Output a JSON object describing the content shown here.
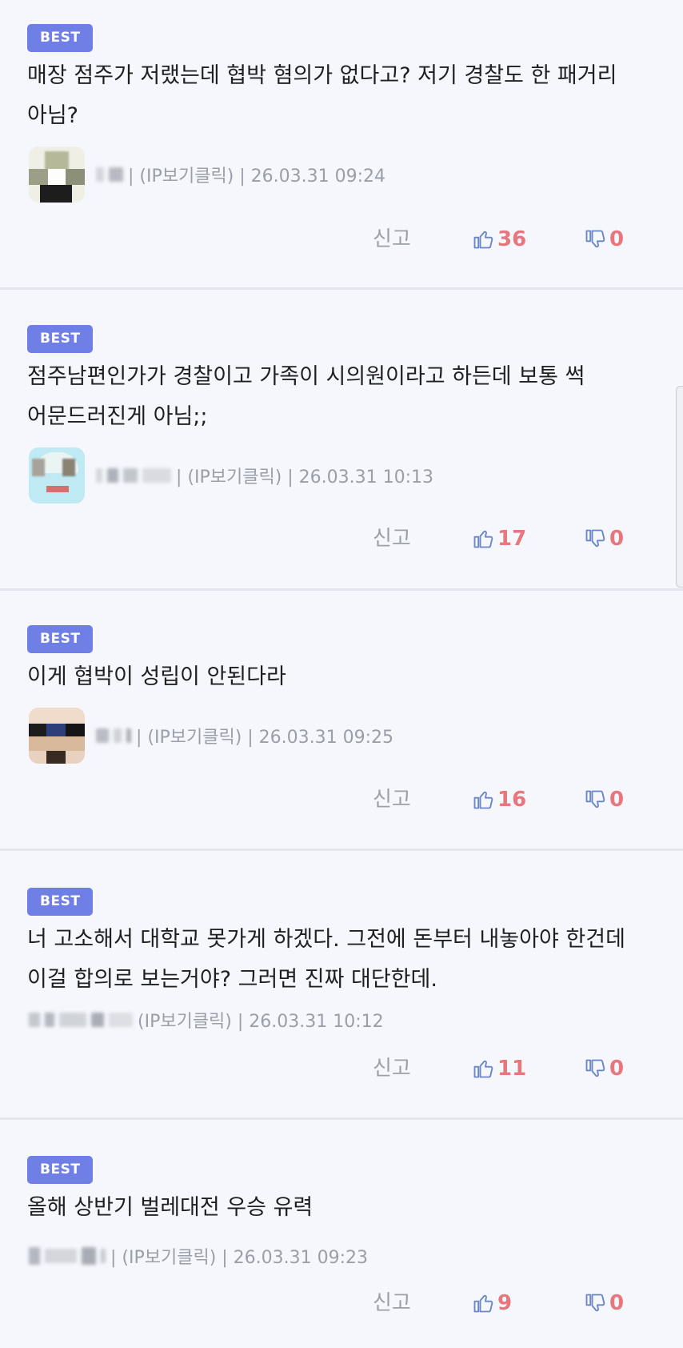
{
  "comments": [
    {
      "badge": "BEST",
      "text": "매장 점주가 저랬는데 협박 혐의가 없다고? 저기 경찰도 한 패거리 아님?",
      "meta": "| (IP보기클릭) | 26.03.31 09:24",
      "report": "신고",
      "likes": "36",
      "dislikes": "0"
    },
    {
      "badge": "BEST",
      "text": "점주남편인가가 경찰이고 가족이 시의원이라고 하든데 보통 썩어문드러진게 아님;;",
      "meta": "| (IP보기클릭) | 26.03.31 10:13",
      "report": "신고",
      "likes": "17",
      "dislikes": "0"
    },
    {
      "badge": "BEST",
      "text": "이게 협박이 성립이 안된다라",
      "meta": "| (IP보기클릭) | 26.03.31 09:25",
      "report": "신고",
      "likes": "16",
      "dislikes": "0"
    },
    {
      "badge": "BEST",
      "text": "너 고소해서 대학교 못가게 하겠다. 그전에 돈부터 내놓아야 한건데 이걸 합의로 보는거야? 그러면 진짜 대단한데.",
      "meta": "(IP보기클릭) | 26.03.31 10:12",
      "report": "신고",
      "likes": "11",
      "dislikes": "0"
    },
    {
      "badge": "BEST",
      "text": "올해 상반기 벌레대전 우승 유력",
      "meta": "| (IP보기클릭) | 26.03.31 09:23",
      "report": "신고",
      "likes": "9",
      "dislikes": "0"
    }
  ],
  "colors": {
    "badge": "#6f7fe6",
    "like_count": "#e8767d",
    "icon": "#6a86c9"
  }
}
